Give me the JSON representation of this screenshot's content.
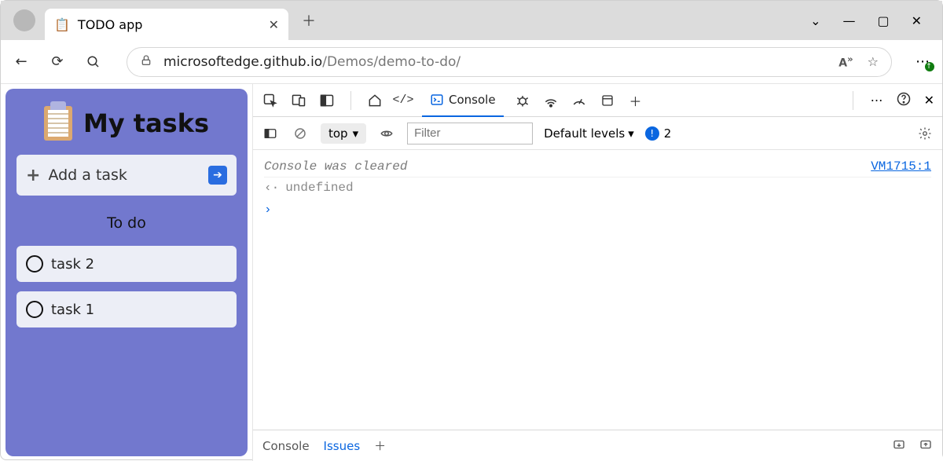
{
  "browser": {
    "tab_title": "TODO app",
    "favicon": "clipboard-icon",
    "url_host": "microsoftedge.github.io",
    "url_path": "/Demos/demo-to-do/"
  },
  "app": {
    "title": "My tasks",
    "add_task_label": "Add a task",
    "section_label": "To do",
    "tasks": [
      {
        "label": "task 2"
      },
      {
        "label": "task 1"
      }
    ]
  },
  "devtools": {
    "active_tab": "Console",
    "context": "top",
    "filter_placeholder": "Filter",
    "levels_label": "Default levels",
    "issue_count": "2",
    "messages": {
      "cleared": "Console was cleared",
      "cleared_source": "VM1715:1",
      "return_value": "undefined"
    },
    "drawer": {
      "tabs": [
        "Console",
        "Issues"
      ],
      "active": "Issues"
    }
  }
}
